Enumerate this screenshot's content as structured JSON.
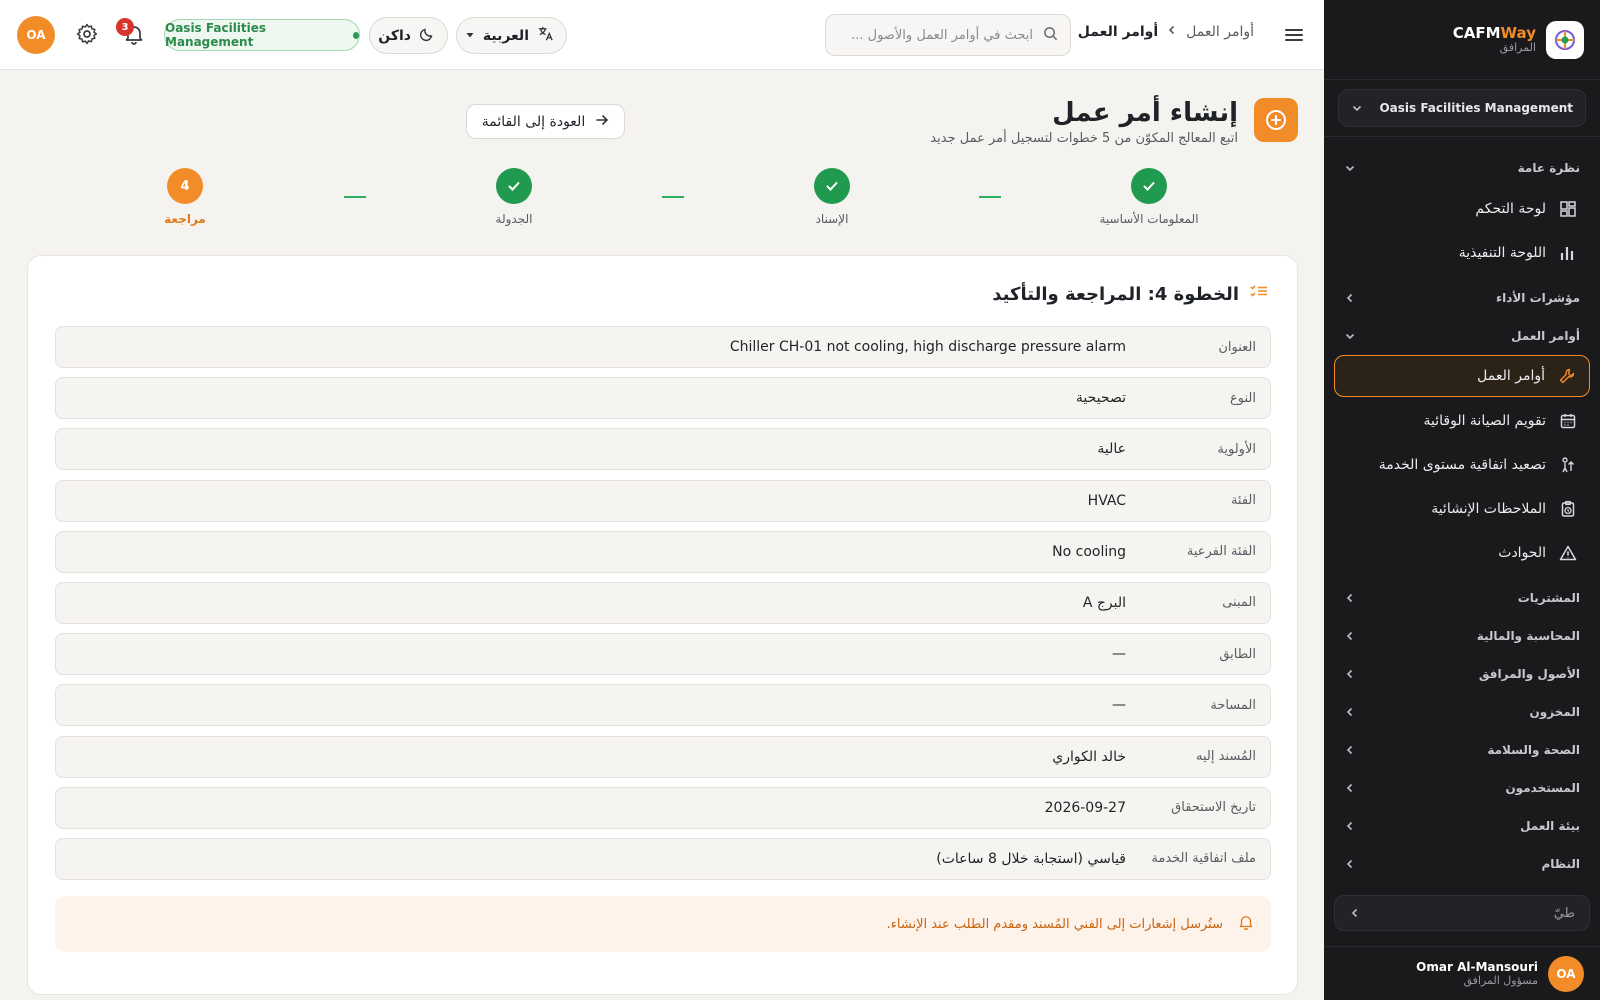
{
  "colors": {
    "accent": "#f28c28",
    "success": "#1f9a4f",
    "sidebar_bg": "#1a1a1d",
    "danger": "#d9342b"
  },
  "topbar": {
    "breadcrumb": {
      "parent": "أوامر العمل",
      "current": "أوامر العمل"
    },
    "search_placeholder": "ابحث في أوامر العمل والأصول ...",
    "language": "العربية",
    "theme": "داكن",
    "org_badge": "Oasis Facilities Management",
    "notification_count": "3",
    "avatar_initials": "OA"
  },
  "page": {
    "title": "إنشاء أمر عمل",
    "subtitle": "اتبع المعالج المكوّن من 5 خطوات لتسجيل أمر عمل جديد",
    "back_label": "العودة إلى القائمة"
  },
  "stepper": {
    "steps": [
      {
        "label": "المعلومات الأساسية",
        "status": "done"
      },
      {
        "label": "الإسناد",
        "status": "done"
      },
      {
        "label": "الجدولة",
        "status": "done"
      },
      {
        "label": "مراجعة",
        "status": "current",
        "number": "4"
      }
    ]
  },
  "review": {
    "title": "الخطوة 4: المراجعة والتأكيد",
    "rows": [
      {
        "label": "العنوان",
        "value": "Chiller CH-01 not cooling, high discharge pressure alarm"
      },
      {
        "label": "النوع",
        "value": "تصحيحية"
      },
      {
        "label": "الأولوية",
        "value": "عالية"
      },
      {
        "label": "الفئة",
        "value": "HVAC"
      },
      {
        "label": "الفئة الفرعية",
        "value": "No cooling"
      },
      {
        "label": "المبنى",
        "value": "البرج A"
      },
      {
        "label": "الطابق",
        "value": "—"
      },
      {
        "label": "المساحة",
        "value": "—"
      },
      {
        "label": "المُسند إليه",
        "value": "خالد الكواري"
      },
      {
        "label": "تاريخ الاستحقاق",
        "value": "2026-09-27"
      },
      {
        "label": "ملف اتفاقية الخدمة",
        "value": "قياسي (استجابة خلال 8 ساعات)"
      }
    ],
    "notice": "ستُرسل إشعارات إلى الفني المُسند ومقدم الطلب عند الإنشاء."
  },
  "sidebar": {
    "brand_name_part1": "CAFM",
    "brand_name_part2": "Way",
    "brand_subtitle": "المرافق",
    "org_selector": "Oasis Facilities Management",
    "sections": {
      "overview": "نظرة عامة",
      "kpis": "مؤشرات الأداء",
      "work_orders": "أوامر العمل",
      "procurement": "المشتريات",
      "finance": "المحاسبة والمالية",
      "assets": "الأصول والمرافق",
      "inventory": "المخزون",
      "hse": "الصحة والسلامة",
      "users": "المستخدمون",
      "environment": "بيئة العمل",
      "system": "النظام"
    },
    "items": {
      "dashboard": "لوحة التحكم",
      "executive": "اللوحة التنفيذية",
      "work_orders": "أوامر العمل",
      "pm_calendar": "تقويم الصيانة الوقائية",
      "sla": "تصعيد اتفاقية مستوى الخدمة",
      "structural": "الملاحظات الإنشائية",
      "incidents": "الحوادث"
    },
    "collapse_label": "طيّ",
    "user": {
      "name": "Omar Al-Mansouri",
      "role": "مسؤول المرافق",
      "initials": "OA"
    }
  }
}
